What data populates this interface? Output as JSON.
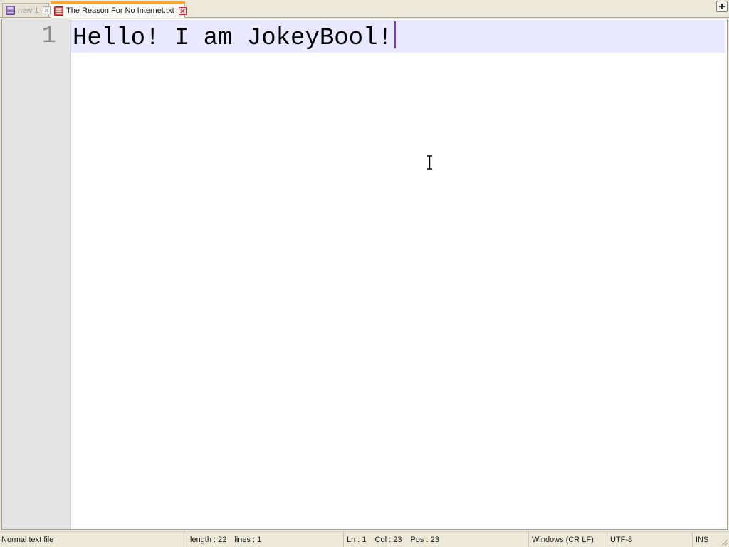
{
  "tabs": [
    {
      "label": "new 1",
      "state": "inactive",
      "icon": "file-saved-icon",
      "close_icon": "close-icon"
    },
    {
      "label": "The Reason For No Internet.txt",
      "state": "active",
      "icon": "file-unsaved-icon",
      "close_icon": "close-icon"
    }
  ],
  "tabbar": {
    "new_tab_icon": "plus-icon"
  },
  "editor": {
    "line_numbers": [
      "1"
    ],
    "lines": [
      "Hello! I am JokeyBool!"
    ],
    "current_line_color": "#E8E8FF",
    "caret_color": "#7A3FA0"
  },
  "statusbar": {
    "file_type": "Normal text file",
    "length": "length : 22",
    "lines": "lines : 1",
    "ln": "Ln : 1",
    "col": "Col : 23",
    "pos": "Pos : 23",
    "eol": "Windows (CR LF)",
    "encoding": "UTF-8",
    "mode": "INS"
  },
  "colors": {
    "active_tab_accent": "#F7A634",
    "chrome": "#ECE9D8"
  }
}
